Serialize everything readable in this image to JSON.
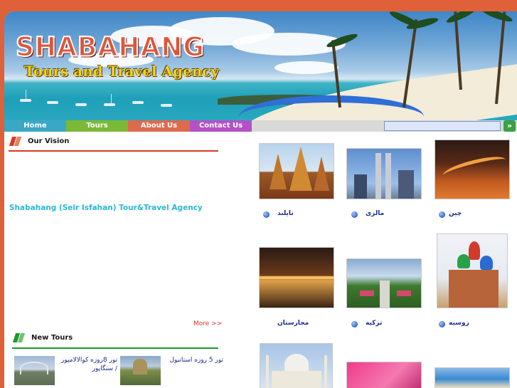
{
  "banner": {
    "logo_main": "SHABAHANG",
    "logo_sub": "Tours and Travel Agency"
  },
  "nav": {
    "items": [
      {
        "label": "Home",
        "color": "#3ba7c6"
      },
      {
        "label": "Tours",
        "color": "#7bb936"
      },
      {
        "label": "About Us",
        "color": "#de6a4e"
      },
      {
        "label": "Contact Us",
        "color": "#b451c6"
      }
    ],
    "search_value": "",
    "go_icon": "double-chevron-right-icon"
  },
  "vision": {
    "title": "Our Vision",
    "agency": "Shabahang (Seir Isfahan) Tour&Travel Agency",
    "more": "More >>",
    "accent": "#d63a2a"
  },
  "new_tours": {
    "title": "New Tours",
    "accent": "#1e9a2a",
    "items": [
      {
        "text": "تور 8روزه کوالالامپور / سنگاپور"
      },
      {
        "text": "تور 5 روزه استانبول"
      }
    ]
  },
  "destinations": [
    {
      "label": "تایلند",
      "scene": "temple"
    },
    {
      "label": "مالزی",
      "scene": "city"
    },
    {
      "label": "چین",
      "scene": "wall"
    },
    {
      "label": "مجارستان",
      "scene": "night"
    },
    {
      "label": "ترکیه",
      "scene": "garden"
    },
    {
      "label": "روسیه",
      "scene": "cathedral"
    },
    {
      "label": "",
      "scene": "tajmahal"
    },
    {
      "label": "",
      "scene": "pink"
    },
    {
      "label": "",
      "scene": "coast"
    }
  ]
}
